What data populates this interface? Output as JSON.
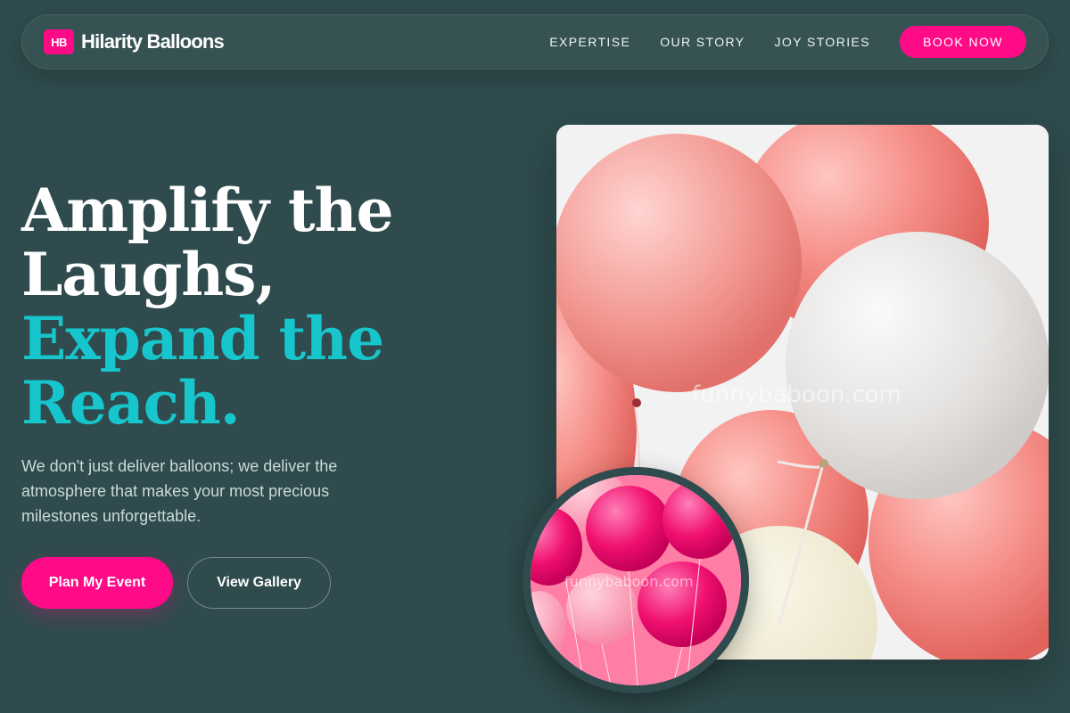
{
  "brand": {
    "badge": "HB",
    "name": "Hilarity Balloons",
    "accent_color": "#ff0a87",
    "highlight_color": "#17c6cd"
  },
  "nav": {
    "links": [
      "EXPERTISE",
      "OUR STORY",
      "JOY STORIES"
    ],
    "cta": "BOOK NOW"
  },
  "hero": {
    "title_line1": "Amplify the",
    "title_line2": "Laughs,",
    "title_line3": "Expand the",
    "title_line4": "Reach.",
    "description": "We don't just deliver balloons; we deliver the atmosphere that makes your most precious milestones unforgettable.",
    "primary_button": "Plan My Event",
    "secondary_button": "View Gallery"
  },
  "images": {
    "main_watermark": "funnybaboon.com",
    "circle_watermark": "funnybaboon.com"
  }
}
